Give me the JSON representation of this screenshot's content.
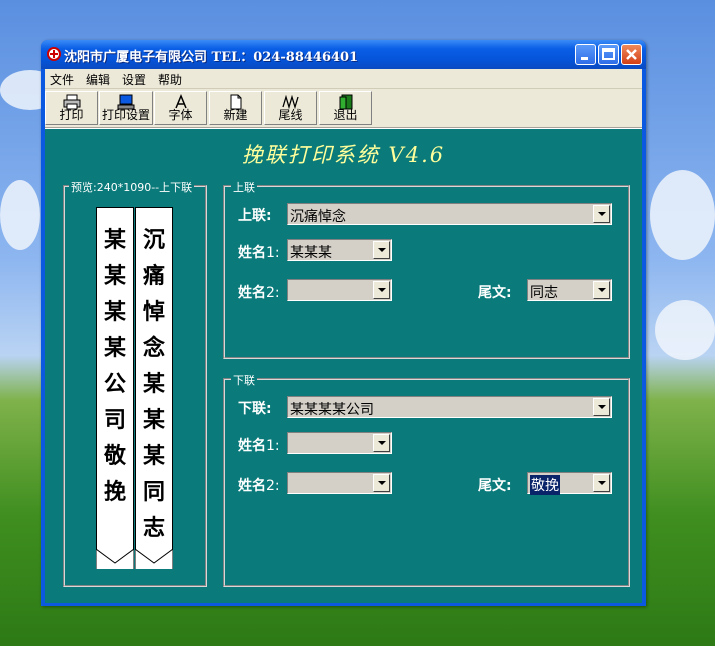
{
  "window": {
    "title": "沈阳市广厦电子有限公司  TEL：024-88446401"
  },
  "menu": [
    "文件",
    "编辑",
    "设置",
    "帮助"
  ],
  "toolbar": [
    {
      "label": "打印",
      "icon": "printer-icon"
    },
    {
      "label": "打印设置",
      "icon": "computer-icon"
    },
    {
      "label": "字体",
      "icon": "font-icon"
    },
    {
      "label": "新建",
      "icon": "new-document-icon"
    },
    {
      "label": "尾线",
      "icon": "tail-line-icon"
    },
    {
      "label": "退出",
      "icon": "exit-door-icon"
    }
  ],
  "app_title": "挽联打印系统 V4.6",
  "preview": {
    "title": "预览:240*1090--上下联",
    "left_scroll": "某某某某公司敬挽",
    "right_scroll": "沉痛悼念某某某同志"
  },
  "upper": {
    "group_title": "上联",
    "label": "上联:",
    "value": "沉痛悼念",
    "name1_label": "姓名",
    "name1_num": "1:",
    "name1_value": "某某某",
    "name2_label": "姓名",
    "name2_num": "2:",
    "name2_value": "",
    "suffix_label": "尾文:",
    "suffix_value": "同志"
  },
  "lower": {
    "group_title": "下联",
    "label": "下联:",
    "value": "某某某某公司",
    "name1_label": "姓名",
    "name1_num": "1:",
    "name1_value": "",
    "name2_label": "姓名",
    "name2_num": "2:",
    "name2_value": "",
    "suffix_label": "尾文:",
    "suffix_value": "敬挽"
  },
  "colors": {
    "client_bg": "#0a7a7a",
    "title_yellow": "#ffff9c",
    "xp_blue": "#0a59e0"
  }
}
